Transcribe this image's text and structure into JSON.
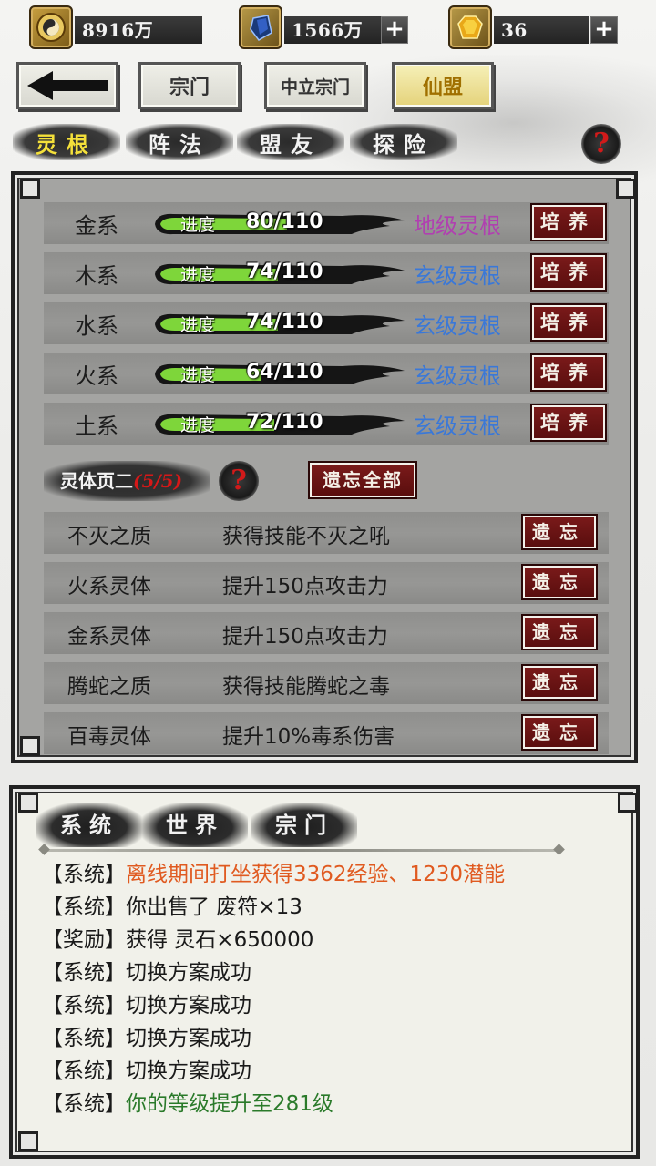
{
  "resources": [
    {
      "icon": "taiji-coin-icon",
      "value": "8916万",
      "has_plus": false
    },
    {
      "icon": "blue-crystal-icon",
      "value": "1566万",
      "has_plus": true
    },
    {
      "icon": "gold-gem-icon",
      "value": "36",
      "has_plus": true
    }
  ],
  "nav": {
    "back_icon": "back-arrow-icon",
    "sect": "宗门",
    "mid_sect": "中立宗门",
    "alliance": "仙盟"
  },
  "tabs": [
    "灵根",
    "阵法",
    "盟友",
    "探险"
  ],
  "active_tab": "灵根",
  "help_text": "?",
  "roots": [
    {
      "name": "金系",
      "label": "进度",
      "value": "80/110",
      "progress": 0.727,
      "grade": "地级灵根",
      "grade_color": "#b040b0",
      "button": "培养"
    },
    {
      "name": "木系",
      "label": "进度",
      "value": "74/110",
      "progress": 0.673,
      "grade": "玄级灵根",
      "grade_color": "#3a78d8",
      "button": "培养"
    },
    {
      "name": "水系",
      "label": "进度",
      "value": "74/110",
      "progress": 0.673,
      "grade": "玄级灵根",
      "grade_color": "#3a78d8",
      "button": "培养"
    },
    {
      "name": "火系",
      "label": "进度",
      "value": "64/110",
      "progress": 0.582,
      "grade": "玄级灵根",
      "grade_color": "#3a78d8",
      "button": "培养"
    },
    {
      "name": "土系",
      "label": "进度",
      "value": "72/110",
      "progress": 0.655,
      "grade": "玄级灵根",
      "grade_color": "#3a78d8",
      "button": "培养"
    }
  ],
  "spirit_body": {
    "title": "灵体页二",
    "count": "(5/5)",
    "forget_all": "遗忘全部",
    "items": [
      {
        "name": "不灭之质",
        "desc": "获得技能不灭之吼",
        "button": "遗忘"
      },
      {
        "name": "火系灵体",
        "desc": "提升150点攻击力",
        "button": "遗忘"
      },
      {
        "name": "金系灵体",
        "desc": "提升150点攻击力",
        "button": "遗忘"
      },
      {
        "name": "腾蛇之质",
        "desc": "获得技能腾蛇之毒",
        "button": "遗忘"
      },
      {
        "name": "百毒灵体",
        "desc": "提升10%毒系伤害",
        "button": "遗忘"
      }
    ]
  },
  "log_tabs": [
    "系统",
    "世界",
    "宗门"
  ],
  "log": [
    {
      "tag": "【系统】",
      "text": "离线期间打坐获得3362经验、1230潜能",
      "color": "#e05a20"
    },
    {
      "tag": "【系统】",
      "text": "你出售了 废符×13",
      "color": "#1a1a1a"
    },
    {
      "tag": "【奖励】",
      "text": "获得 灵石×650000",
      "color": "#1a1a1a"
    },
    {
      "tag": "【系统】",
      "text": "切换方案成功",
      "color": "#1a1a1a"
    },
    {
      "tag": "【系统】",
      "text": "切换方案成功",
      "color": "#1a1a1a"
    },
    {
      "tag": "【系统】",
      "text": "切换方案成功",
      "color": "#1a1a1a"
    },
    {
      "tag": "【系统】",
      "text": "切换方案成功",
      "color": "#1a1a1a"
    },
    {
      "tag": "【系统】",
      "text": "你的等级提升至281级",
      "color": "#2a7a2a"
    }
  ]
}
